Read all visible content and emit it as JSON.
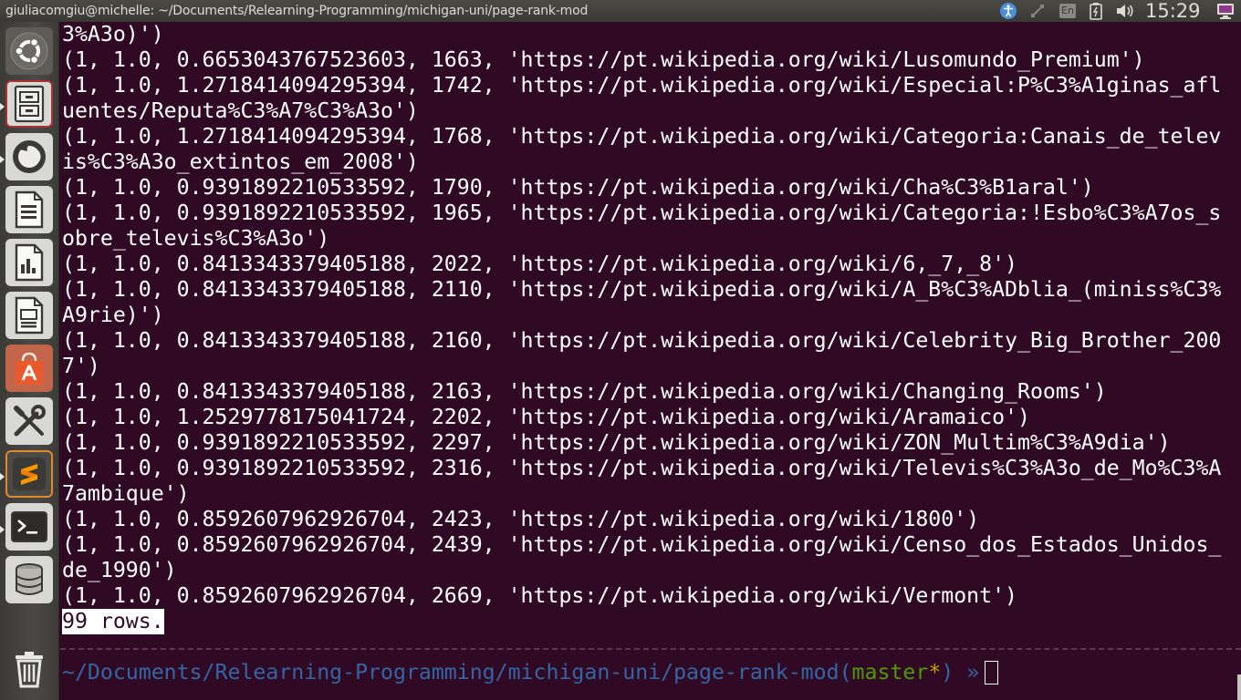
{
  "window": {
    "title": "giuliacomgiu@michelle: ~/Documents/Relearning-Programming/michigan-uni/page-rank-mod"
  },
  "tray": {
    "keyboard_layout": "En",
    "clock": "15:29",
    "icons": [
      "accessibility-icon",
      "network-icon",
      "keyboard-icon",
      "battery-icon",
      "volume-icon",
      "session-icon"
    ]
  },
  "launcher": {
    "items": [
      {
        "name": "dash-button",
        "icon": "ubuntu-logo-icon"
      },
      {
        "name": "files-button",
        "icon": "file-cabinet-icon"
      },
      {
        "name": "firefox-button",
        "icon": "firefox-icon"
      },
      {
        "name": "writer-button",
        "icon": "document-icon"
      },
      {
        "name": "calc-button",
        "icon": "spreadsheet-icon"
      },
      {
        "name": "impress-button",
        "icon": "presentation-icon"
      },
      {
        "name": "software-center-button",
        "icon": "shopping-bag-icon"
      },
      {
        "name": "system-settings-button",
        "icon": "wrench-screwdriver-icon"
      },
      {
        "name": "sublime-text-button",
        "icon": "sublime-icon"
      },
      {
        "name": "terminal-button",
        "icon": "terminal-icon"
      },
      {
        "name": "database-button",
        "icon": "database-icon"
      },
      {
        "name": "trash-button",
        "icon": "trash-icon"
      }
    ]
  },
  "terminal": {
    "lines": [
      "3%A3o)')",
      "(1, 1.0, 0.6653043767523603, 1663, 'https://pt.wikipedia.org/wiki/Lusomundo_Premium')",
      "(1, 1.0, 1.2718414094295394, 1742, 'https://pt.wikipedia.org/wiki/Especial:P%C3%A1ginas_afl",
      "uentes/Reputa%C3%A7%C3%A3o')",
      "(1, 1.0, 1.2718414094295394, 1768, 'https://pt.wikipedia.org/wiki/Categoria:Canais_de_telev",
      "is%C3%A3o_extintos_em_2008')",
      "(1, 1.0, 0.9391892210533592, 1790, 'https://pt.wikipedia.org/wiki/Cha%C3%B1aral')",
      "(1, 1.0, 0.9391892210533592, 1965, 'https://pt.wikipedia.org/wiki/Categoria:!Esbo%C3%A7os_s",
      "obre_televis%C3%A3o')",
      "(1, 1.0, 0.8413343379405188, 2022, 'https://pt.wikipedia.org/wiki/6,_7,_8')",
      "(1, 1.0, 0.8413343379405188, 2110, 'https://pt.wikipedia.org/wiki/A_B%C3%ADblia_(miniss%C3%",
      "A9rie)')",
      "(1, 1.0, 0.8413343379405188, 2160, 'https://pt.wikipedia.org/wiki/Celebrity_Big_Brother_200",
      "7')",
      "(1, 1.0, 0.8413343379405188, 2163, 'https://pt.wikipedia.org/wiki/Changing_Rooms')",
      "(1, 1.0, 1.2529778175041724, 2202, 'https://pt.wikipedia.org/wiki/Aramaico')",
      "(1, 1.0, 0.9391892210533592, 2297, 'https://pt.wikipedia.org/wiki/ZON_Multim%C3%A9dia')",
      "(1, 1.0, 0.9391892210533592, 2316, 'https://pt.wikipedia.org/wiki/Televis%C3%A3o_de_Mo%C3%A",
      "7ambique')",
      "(1, 1.0, 0.8592607962926704, 2423, 'https://pt.wikipedia.org/wiki/1800')",
      "(1, 1.0, 0.8592607962926704, 2439, 'https://pt.wikipedia.org/wiki/Censo_dos_Estados_Unidos_",
      "de_1990')",
      "(1, 1.0, 0.8592607962926704, 2669, 'https://pt.wikipedia.org/wiki/Vermont')"
    ],
    "rows_summary": "99 rows.",
    "prompt": {
      "path": "~/Documents/Relearning-Programming/michigan-uni/page-rank-mod",
      "open_paren": "(",
      "branch": "master",
      "dirty_marker": "*",
      "close_paren": ")",
      "arrow": "»"
    },
    "colors": {
      "background": "#300a24",
      "text": "#ffffff",
      "prompt_path": "#3465a4",
      "prompt_branch": "#4e9a06",
      "prompt_dirty": "#c4a000"
    }
  }
}
